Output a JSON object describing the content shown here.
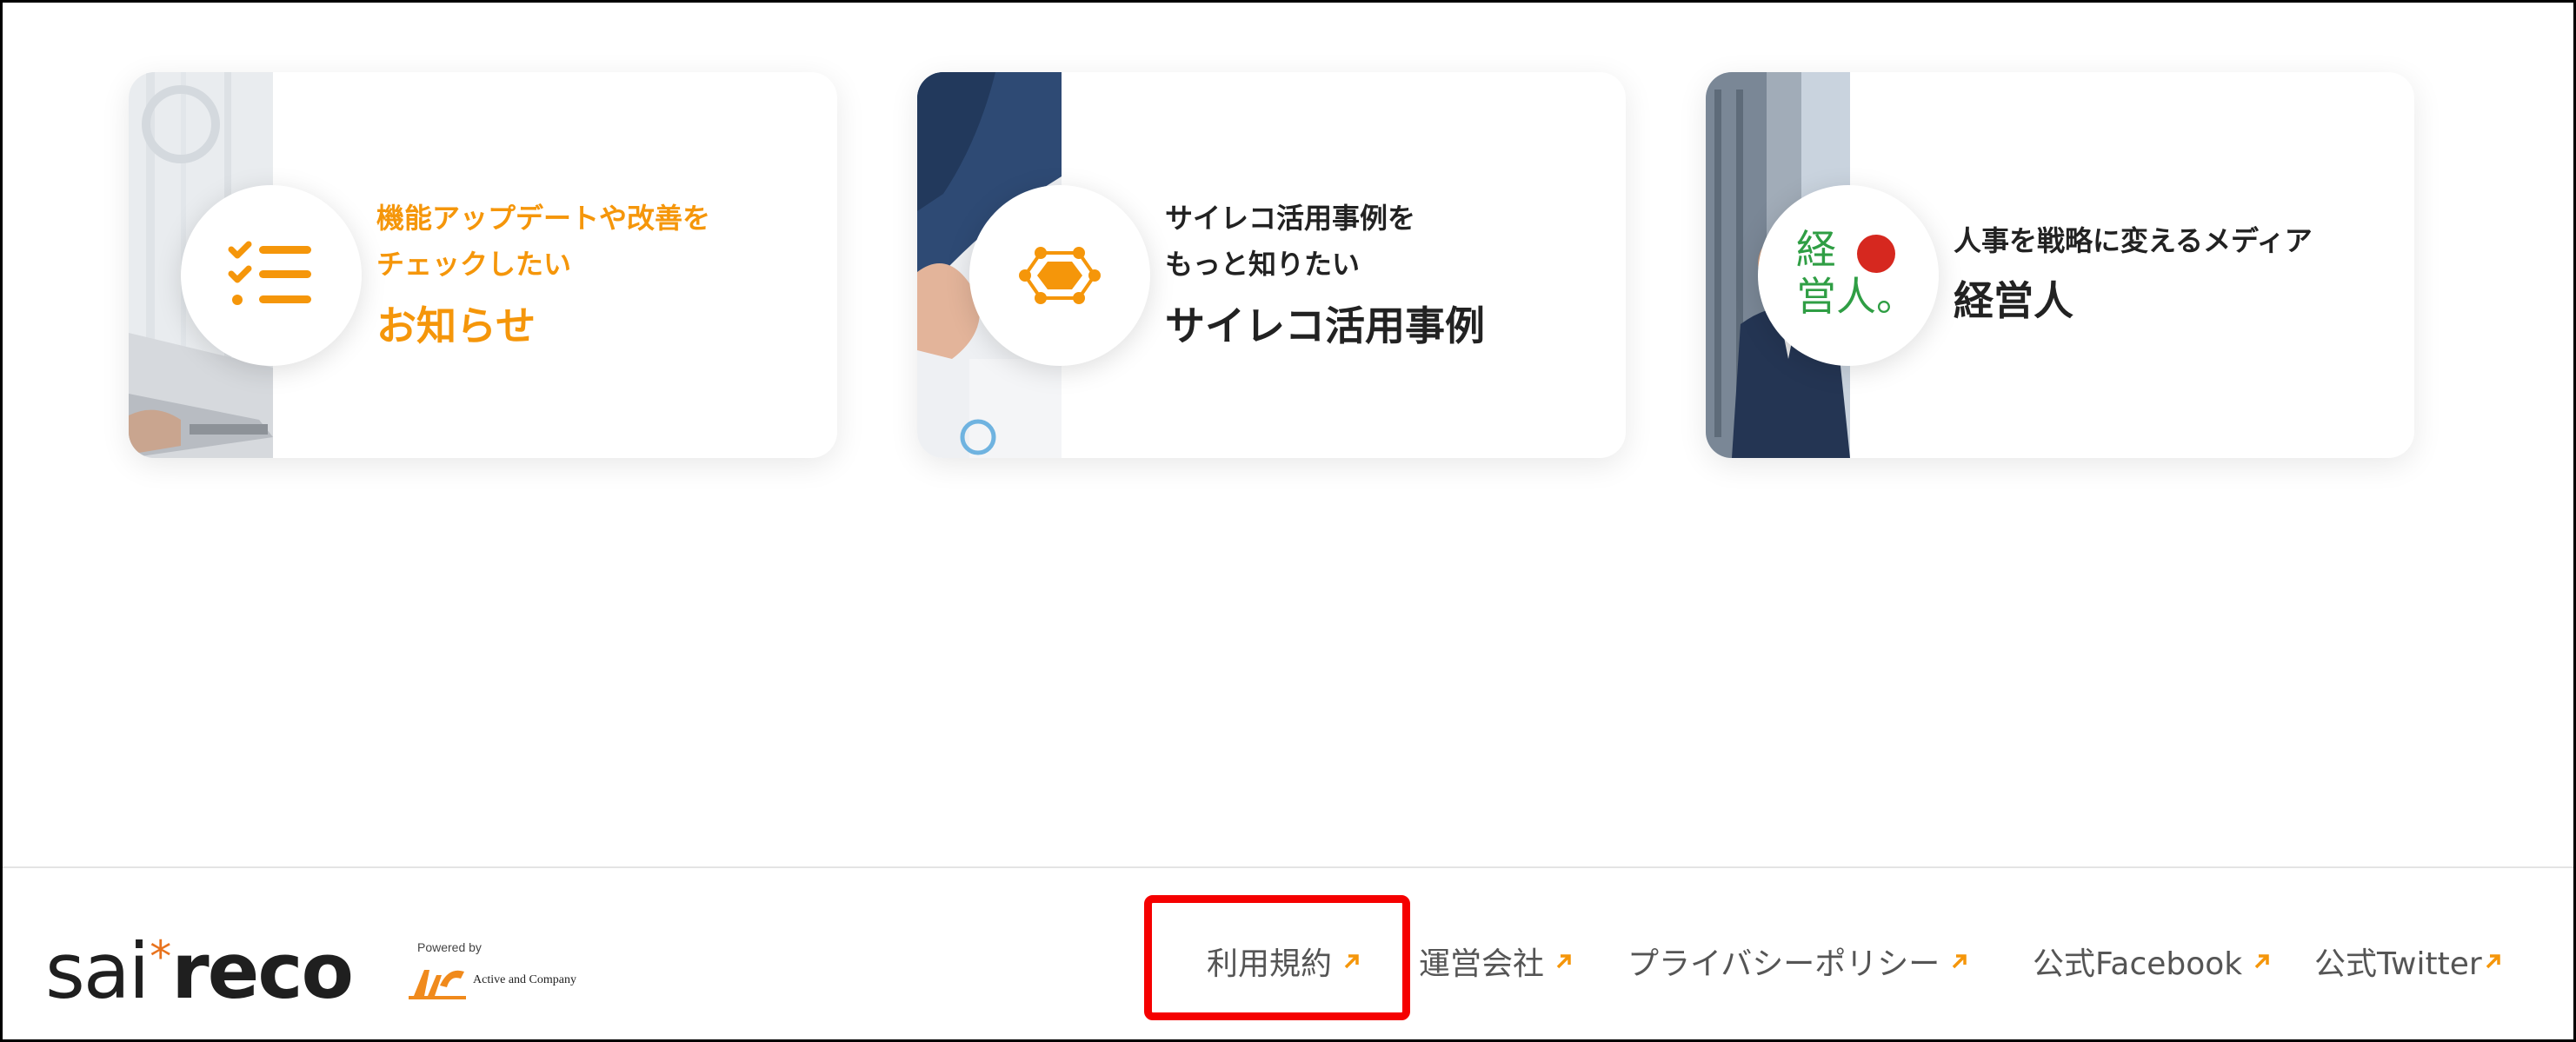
{
  "cards": [
    {
      "subtitle_lines": [
        "機能アップデートや改善を",
        "チェックしたい"
      ],
      "title": "お知らせ",
      "icon": "checklist-icon",
      "color": "#f5960a"
    },
    {
      "subtitle_lines": [
        "サイレコ活用事例を",
        "もっと知りたい"
      ],
      "title": "サイレコ活用事例",
      "icon": "hexagon-network-icon",
      "color": "#f5960a"
    },
    {
      "subtitle_lines": [
        "人事を戦略に変えるメディア"
      ],
      "title": "経営人",
      "icon": "keieijin-logo",
      "icon_text": [
        "経",
        "営人。"
      ]
    }
  ],
  "footer": {
    "logo": {
      "brand_light": "sai",
      "brand_star": "*",
      "brand_bold": "reco",
      "powered_by": "Powered by",
      "company": "Active and Company"
    },
    "links": [
      {
        "label": "利用規約",
        "highlighted": true
      },
      {
        "label": "運営会社"
      },
      {
        "label": "プライバシーポリシー"
      },
      {
        "label": "公式Facebook"
      },
      {
        "label": "公式Twitter"
      }
    ],
    "accent_color": "#f5960a",
    "highlight_color": "#f50000"
  }
}
